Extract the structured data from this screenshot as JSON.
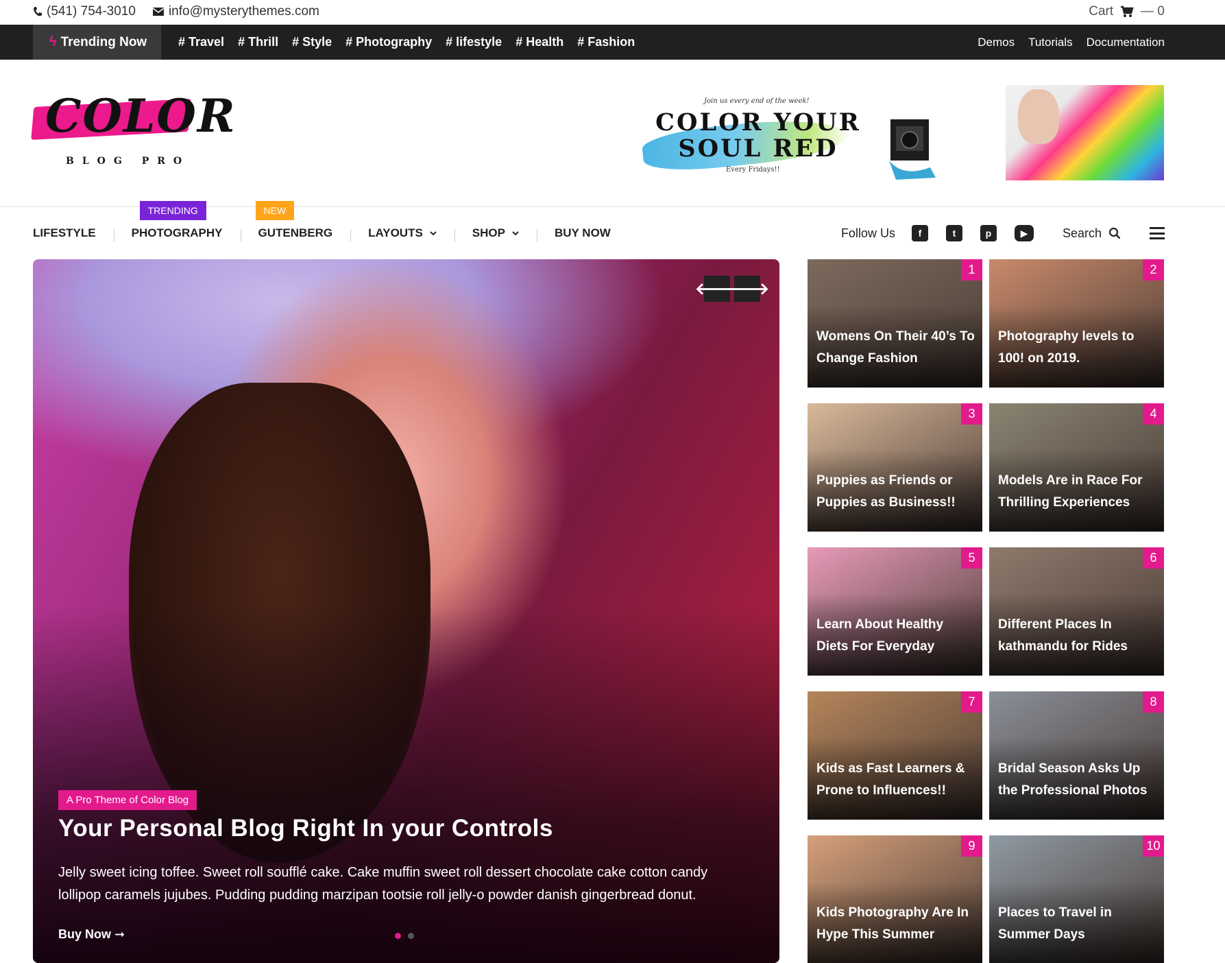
{
  "topbar": {
    "phone": "(541) 754-3010",
    "email": "info@mysterythemes.com",
    "cart_label": "Cart",
    "cart_count": "— 0"
  },
  "trending": {
    "label": "Trending Now",
    "tags": [
      "# Travel",
      "# Thrill",
      "# Style",
      "# Photography",
      "# lifestyle",
      "# Health",
      "# Fashion"
    ],
    "links": [
      "Demos",
      "Tutorials",
      "Documentation"
    ]
  },
  "logo": {
    "word": "COLOR",
    "sub": "BLOG PRO"
  },
  "banner": {
    "small_top": "Join us every end of the week!",
    "headline": "COLOR YOUR SOUL RED",
    "small_bottom": "Every Fridays!!"
  },
  "nav": {
    "items": [
      "LIFESTYLE",
      "PHOTOGRAPHY",
      "GUTENBERG",
      "LAYOUTS",
      "SHOP",
      "BUY NOW"
    ],
    "badge_trending": "TRENDING",
    "badge_new": "NEW",
    "follow_label": "Follow Us",
    "search_label": "Search"
  },
  "hero": {
    "category": "A Pro Theme of Color Blog",
    "title": "Your Personal Blog Right In your Controls",
    "text": "Jelly sweet icing toffee. Sweet roll soufflé cake. Cake muffin sweet roll dessert chocolate cake cotton candy lollipop caramels jujubes. Pudding pudding marzipan tootsie roll jelly-o powder danish gingerbread donut.",
    "read_more": "Buy Now ➞",
    "prev": "🡐",
    "next": "🡒"
  },
  "posts": [
    {
      "num": "1",
      "title": "Womens On Their 40’s To Change Fashion",
      "color": "#7c6a5c"
    },
    {
      "num": "2",
      "title": "Photography levels to 100! on 2019.",
      "color": "#c98a6a"
    },
    {
      "num": "3",
      "title": "Puppies as Friends or Puppies as Business!!",
      "color": "#d9b99a"
    },
    {
      "num": "4",
      "title": "Models Are in Race For Thrilling Experiences",
      "color": "#8a8472"
    },
    {
      "num": "5",
      "title": "Learn About Healthy Diets For Everyday",
      "color": "#e79ab8"
    },
    {
      "num": "6",
      "title": "Different Places In kathmandu for Rides",
      "color": "#8f7a6c"
    },
    {
      "num": "7",
      "title": "Kids as Fast Learners & Prone to Influences!!",
      "color": "#b5855a"
    },
    {
      "num": "8",
      "title": "Bridal Season Asks Up the Professional Photos",
      "color": "#8a8f98"
    },
    {
      "num": "9",
      "title": "Kids Photography Are In Hype This Summer",
      "color": "#d6a07a"
    },
    {
      "num": "10",
      "title": "Places to Travel in Summer Days",
      "color": "#8f9aa3"
    }
  ]
}
